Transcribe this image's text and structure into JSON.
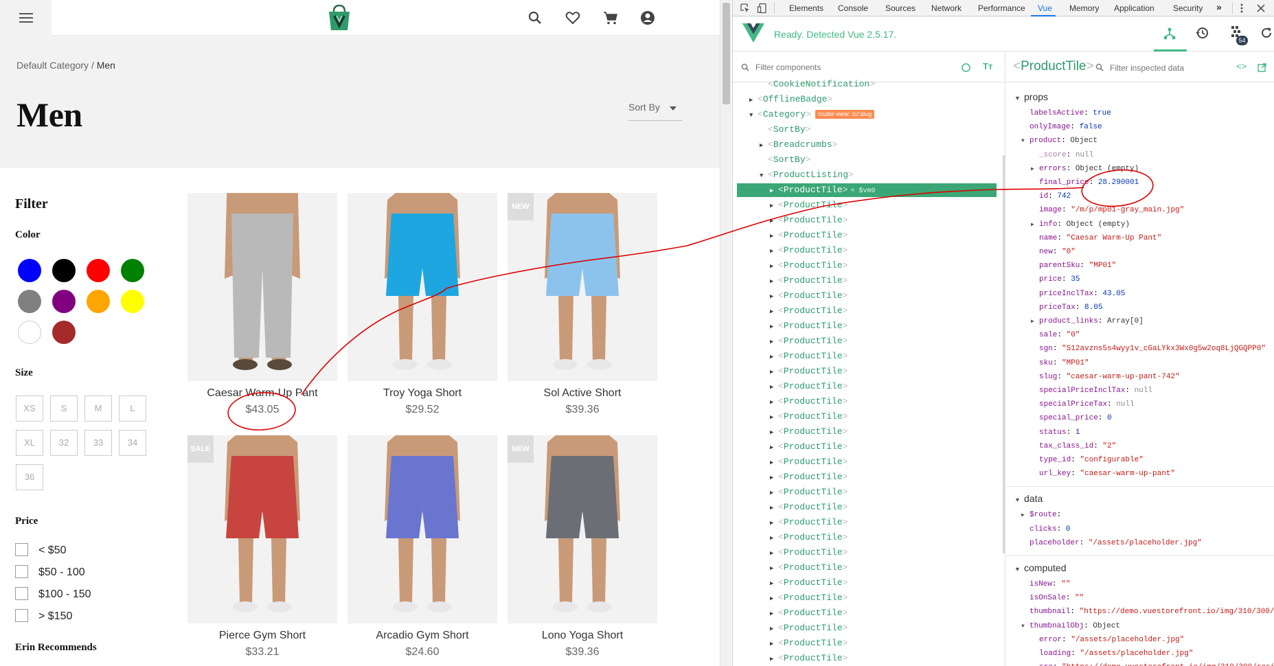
{
  "store": {
    "breadcrumb": {
      "parent": "Default Category",
      "sep": " / ",
      "current": "Men"
    },
    "title": "Men",
    "sort_label": "Sort By",
    "sidebar": {
      "filter_heading": "Filter",
      "color_heading": "Color",
      "colors": [
        "#0000ff",
        "#000000",
        "#ff0000",
        "#008000",
        "#808080",
        "#800080",
        "#ffa500",
        "#ffff00",
        "#ffffff",
        "#a52a2a"
      ],
      "size_heading": "Size",
      "sizes": [
        "XS",
        "S",
        "M",
        "L",
        "XL",
        "32",
        "33",
        "34",
        "36"
      ],
      "price_heading": "Price",
      "price_ranges": [
        "< $50",
        "$50 - 100",
        "$100 - 150",
        "> $150"
      ],
      "recommends_heading": "Erin Recommends"
    },
    "products": [
      {
        "name": "Caesar Warm-Up Pant",
        "price": "$43.05",
        "badge": ""
      },
      {
        "name": "Troy Yoga Short",
        "price": "$29.52",
        "badge": ""
      },
      {
        "name": "Sol Active Short",
        "price": "$39.36",
        "badge": "NEW"
      },
      {
        "name": "Pierce Gym Short",
        "price": "$33.21",
        "badge": "SALE"
      },
      {
        "name": "Arcadio Gym Short",
        "price": "$24.60",
        "badge": ""
      },
      {
        "name": "Lono Yoga Short",
        "price": "$39.36",
        "badge": "NEW"
      }
    ],
    "product_colors": [
      "#b9b9b9",
      "#1ea6e0",
      "#8cc3ec",
      "#c8453f",
      "#6a75cf",
      "#6b6e75"
    ],
    "skin_color": "#c99a78"
  },
  "devtools": {
    "tabs": [
      "Elements",
      "Console",
      "Sources",
      "Network",
      "Performance",
      "Vue",
      "Memory",
      "Application",
      "Security"
    ],
    "more": "»",
    "vue_status": "Ready. Detected Vue 2.5.17.",
    "vuex_badge": "54",
    "filter_components_placeholder": "Filter components",
    "tree": [
      {
        "name": "CookieNotification",
        "depth": 4,
        "tri": ""
      },
      {
        "name": "OfflineBadge",
        "depth": 3,
        "tri": "▶"
      },
      {
        "name": "Category",
        "depth": 3,
        "tri": "▼",
        "badge": "router-view: /c/:slug"
      },
      {
        "name": "SortBy",
        "depth": 4,
        "tri": ""
      },
      {
        "name": "Breadcrumbs",
        "depth": 4,
        "tri": "▶"
      },
      {
        "name": "SortBy",
        "depth": 4,
        "tri": ""
      },
      {
        "name": "ProductListing",
        "depth": 4,
        "tri": "▼"
      },
      {
        "name": "ProductTile",
        "depth": 5,
        "tri": "▶",
        "selected": true,
        "vm": "= $vm0"
      },
      {
        "name": "ProductTile",
        "depth": 5,
        "tri": "▶"
      },
      {
        "name": "ProductTile",
        "depth": 5,
        "tri": "▶"
      },
      {
        "name": "ProductTile",
        "depth": 5,
        "tri": "▶"
      },
      {
        "name": "ProductTile",
        "depth": 5,
        "tri": "▶"
      },
      {
        "name": "ProductTile",
        "depth": 5,
        "tri": "▶"
      },
      {
        "name": "ProductTile",
        "depth": 5,
        "tri": "▶"
      },
      {
        "name": "ProductTile",
        "depth": 5,
        "tri": "▶"
      },
      {
        "name": "ProductTile",
        "depth": 5,
        "tri": "▶"
      },
      {
        "name": "ProductTile",
        "depth": 5,
        "tri": "▶"
      },
      {
        "name": "ProductTile",
        "depth": 5,
        "tri": "▶"
      },
      {
        "name": "ProductTile",
        "depth": 5,
        "tri": "▶"
      },
      {
        "name": "ProductTile",
        "depth": 5,
        "tri": "▶"
      },
      {
        "name": "ProductTile",
        "depth": 5,
        "tri": "▶"
      },
      {
        "name": "ProductTile",
        "depth": 5,
        "tri": "▶"
      },
      {
        "name": "ProductTile",
        "depth": 5,
        "tri": "▶"
      },
      {
        "name": "ProductTile",
        "depth": 5,
        "tri": "▶"
      },
      {
        "name": "ProductTile",
        "depth": 5,
        "tri": "▶"
      },
      {
        "name": "ProductTile",
        "depth": 5,
        "tri": "▶"
      },
      {
        "name": "ProductTile",
        "depth": 5,
        "tri": "▶"
      },
      {
        "name": "ProductTile",
        "depth": 5,
        "tri": "▶"
      },
      {
        "name": "ProductTile",
        "depth": 5,
        "tri": "▶"
      },
      {
        "name": "ProductTile",
        "depth": 5,
        "tri": "▶"
      },
      {
        "name": "ProductTile",
        "depth": 5,
        "tri": "▶"
      },
      {
        "name": "ProductTile",
        "depth": 5,
        "tri": "▶"
      },
      {
        "name": "ProductTile",
        "depth": 5,
        "tri": "▶"
      },
      {
        "name": "ProductTile",
        "depth": 5,
        "tri": "▶"
      },
      {
        "name": "ProductTile",
        "depth": 5,
        "tri": "▶"
      },
      {
        "name": "ProductTile",
        "depth": 5,
        "tri": "▶"
      },
      {
        "name": "ProductTile",
        "depth": 5,
        "tri": "▶"
      },
      {
        "name": "ProductTile",
        "depth": 5,
        "tri": "▶"
      },
      {
        "name": "ProductTile",
        "depth": 5,
        "tri": "▶"
      },
      {
        "name": "ProductTile",
        "depth": 5,
        "tri": "▶"
      }
    ],
    "inspector": {
      "component": "ProductTile",
      "filter_placeholder": "Filter inspected data",
      "sections": [
        {
          "title": "props",
          "rows": [
            {
              "k": "labelsActive",
              "v": "true",
              "t": "bool",
              "d": 0
            },
            {
              "k": "onlyImage",
              "v": "false",
              "t": "bool",
              "d": 0
            },
            {
              "k": "product",
              "v": "Object",
              "t": "obj",
              "d": 0,
              "tri": "▼"
            },
            {
              "k": "_score",
              "v": "null",
              "t": "null",
              "d": 1,
              "dim": true
            },
            {
              "k": "errors",
              "v": "Object (empty)",
              "t": "obj",
              "d": 1,
              "tri": "▶"
            },
            {
              "k": "final_price",
              "v": "28.290001",
              "t": "num",
              "d": 1
            },
            {
              "k": "id",
              "v": "742",
              "t": "num",
              "d": 1
            },
            {
              "k": "image",
              "v": "\"/m/p/mp01-gray_main.jpg\"",
              "t": "str",
              "d": 1
            },
            {
              "k": "info",
              "v": "Object (empty)",
              "t": "obj",
              "d": 1,
              "tri": "▶"
            },
            {
              "k": "name",
              "v": "\"Caesar Warm-Up Pant\"",
              "t": "str",
              "d": 1
            },
            {
              "k": "new",
              "v": "\"0\"",
              "t": "str",
              "d": 1
            },
            {
              "k": "parentSku",
              "v": "\"MP01\"",
              "t": "str",
              "d": 1
            },
            {
              "k": "price",
              "v": "35",
              "t": "num",
              "d": 1
            },
            {
              "k": "priceInclTax",
              "v": "43.05",
              "t": "num",
              "d": 1
            },
            {
              "k": "priceTax",
              "v": "8.05",
              "t": "num",
              "d": 1
            },
            {
              "k": "product_links",
              "v": "Array[0]",
              "t": "obj",
              "d": 1,
              "tri": "▶"
            },
            {
              "k": "sale",
              "v": "\"0\"",
              "t": "str",
              "d": 1
            },
            {
              "k": "sgn",
              "v": "\"S12avzns5s4wyy1v_cGaLYkx3Wx0g5w2oq8LjQGQPP0\"",
              "t": "str",
              "d": 1
            },
            {
              "k": "sku",
              "v": "\"MP01\"",
              "t": "str",
              "d": 1
            },
            {
              "k": "slug",
              "v": "\"caesar-warm-up-pant-742\"",
              "t": "str",
              "d": 1
            },
            {
              "k": "specialPriceInclTax",
              "v": "null",
              "t": "null",
              "d": 1
            },
            {
              "k": "specialPriceTax",
              "v": "null",
              "t": "null",
              "d": 1
            },
            {
              "k": "special_price",
              "v": "0",
              "t": "num",
              "d": 1
            },
            {
              "k": "status",
              "v": "1",
              "t": "num",
              "d": 1
            },
            {
              "k": "tax_class_id",
              "v": "\"2\"",
              "t": "str",
              "d": 1
            },
            {
              "k": "type_id",
              "v": "\"configurable\"",
              "t": "str",
              "d": 1
            },
            {
              "k": "url_key",
              "v": "\"caesar-warm-up-pant\"",
              "t": "str",
              "d": 1
            }
          ]
        },
        {
          "title": "data",
          "rows": [
            {
              "k": "$route",
              "v": "",
              "t": "obj",
              "d": 0,
              "tri": "▶"
            },
            {
              "k": "clicks",
              "v": "0",
              "t": "num",
              "d": 0
            },
            {
              "k": "placeholder",
              "v": "\"/assets/placeholder.jpg\"",
              "t": "str",
              "d": 0
            }
          ]
        },
        {
          "title": "computed",
          "rows": [
            {
              "k": "isNew",
              "v": "\"\"",
              "t": "str",
              "d": 0
            },
            {
              "k": "isOnSale",
              "v": "\"\"",
              "t": "str",
              "d": 0
            },
            {
              "k": "thumbnail",
              "v": "\"https://demo.vuestorefront.io/img/310/300/resize/m/p/mp01-gray_main.jpg\"",
              "t": "str",
              "d": 0
            },
            {
              "k": "thumbnailObj",
              "v": "Object",
              "t": "obj",
              "d": 0,
              "tri": "▼"
            },
            {
              "k": "error",
              "v": "\"/assets/placeholder.jpg\"",
              "t": "str",
              "d": 1
            },
            {
              "k": "loading",
              "v": "\"/assets/placeholder.jpg\"",
              "t": "str",
              "d": 1
            },
            {
              "k": "src",
              "v": "\"https://demo.vuestorefront.io/img/310/300/resize/m/p/mp01-gray_main.jpg\"",
              "t": "str",
              "d": 1
            }
          ]
        }
      ]
    }
  },
  "colors": {
    "vue_green": "#42b983",
    "selected_row": "#3ba776",
    "annotation_red": "#dd0000"
  }
}
